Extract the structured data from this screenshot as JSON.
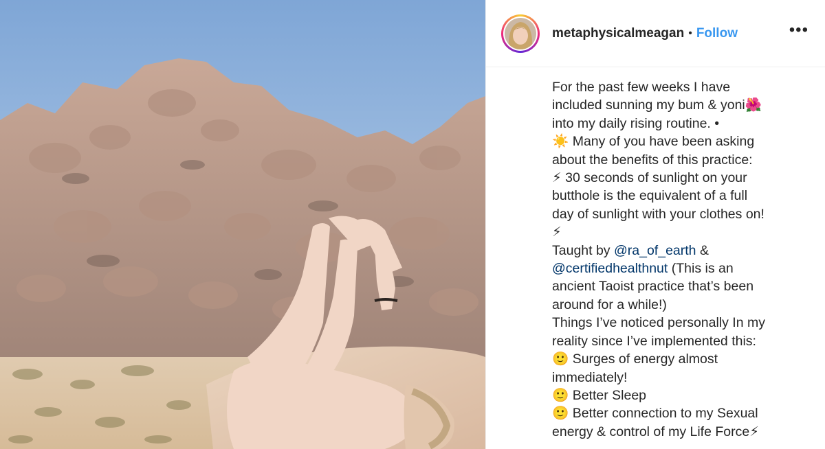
{
  "post": {
    "username": "metaphysicalmeagan",
    "separator": "•",
    "follow_label": "Follow",
    "more_label": "•••"
  },
  "icons": {
    "sun": "☀️",
    "hibiscus": "🌺",
    "lightning": "⚡",
    "smile": "🙂"
  },
  "caption": {
    "line1": "For the past few weeks I have",
    "line2": "included sunning my bum & yoni",
    "line3": "into my daily rising routine. •",
    "line4": " Many of you have been asking",
    "line5": "about the benefits of this practice:",
    "line6": " 30 seconds of sunlight on your",
    "line7": "butthole is the equivalent of a full",
    "line8": "day of sunlight with your clothes on!",
    "line10_pre": "Taught by ",
    "mention1": "@ra_of_earth",
    "line10_post": " &",
    "mention2": "@certifiedhealthnut",
    "line11_post": " (This is an",
    "line12": "ancient Taoist practice that’s been",
    "line13": "around for a while!)",
    "line14": "Things I’ve noticed personally In my",
    "line15": "reality since I’ve implemented this:",
    "line16": " Surges of energy almost",
    "line17": "immediately!",
    "line18": " Better Sleep",
    "line19": " Better connection to my Sexual",
    "line20": "energy & control of my Life Force"
  }
}
